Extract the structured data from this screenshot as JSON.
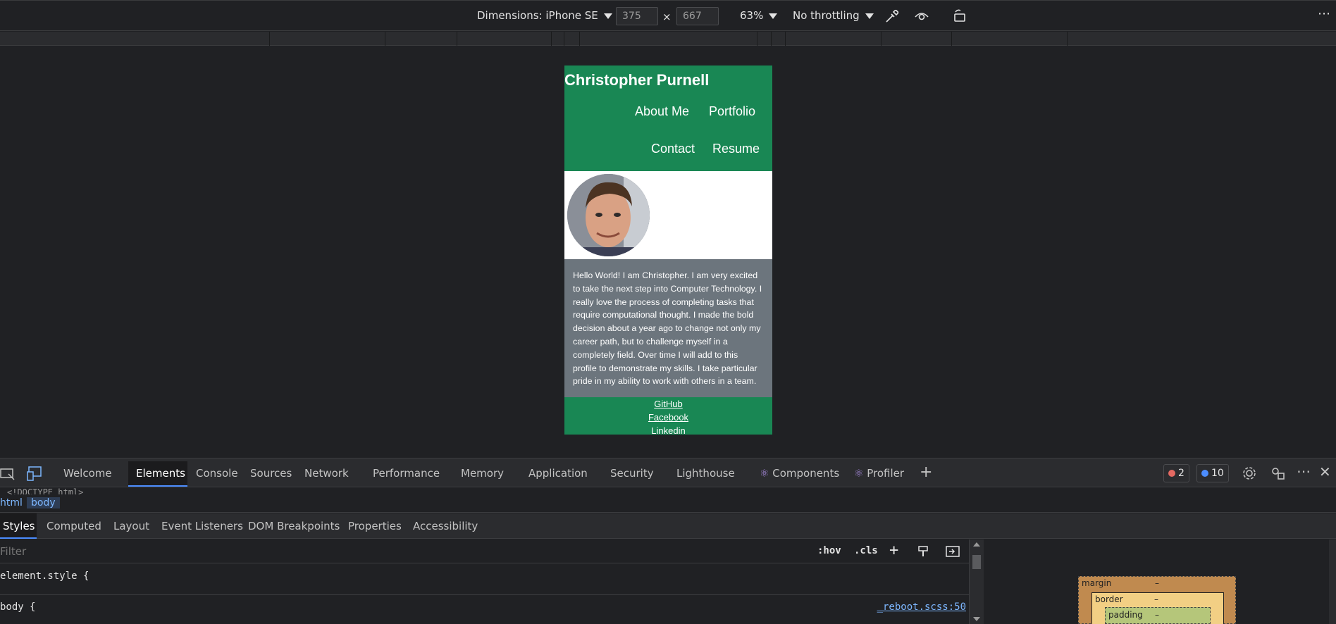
{
  "device_toolbar": {
    "dimensions_label": "Dimensions: iPhone SE",
    "width_value": "375",
    "height_value": "667",
    "times": "×",
    "zoom": "63%",
    "throttling": "No throttling",
    "more": "⋯"
  },
  "site": {
    "title": "Christopher Purnell",
    "nav": [
      "About Me",
      "Portfolio",
      "Contact",
      "Resume"
    ],
    "bio": "Hello World! I am Christopher. I am very excited to take the next step into Computer Technology. I really love the process of completing tasks that require computational thought. I made the bold decision about a year ago to change not only my career path, but to challenge myself in a completely field. Over time I will add to this profile to demonstrate my skills. I take particular pride in my ability to work with others in a team.",
    "footer_links": [
      "GitHub",
      "Facebook",
      "Linkedin"
    ],
    "colors": {
      "green": "#198754",
      "gray": "#6c757d"
    }
  },
  "devtools": {
    "tabs": [
      "Welcome",
      "Elements",
      "Console",
      "Sources",
      "Network",
      "Performance",
      "Memory",
      "Application",
      "Security",
      "Lighthouse",
      "Components",
      "Profiler"
    ],
    "add_tab": "+",
    "errors": "2",
    "messages": "10",
    "doctype": "<!DOCTYPE html>",
    "breadcrumbs": [
      "html",
      "body"
    ],
    "subtabs": [
      "Styles",
      "Computed",
      "Layout",
      "Event Listeners",
      "DOM Breakpoints",
      "Properties",
      "Accessibility"
    ],
    "filter_placeholder": "Filter",
    "hov": ":hov",
    "cls": ".cls",
    "element_style": "element.style {",
    "body_rule": "body {",
    "body_source": "_reboot.scss:50",
    "box_model": {
      "margin": "margin",
      "border": "border",
      "padding": "padding",
      "dash": "–"
    }
  }
}
